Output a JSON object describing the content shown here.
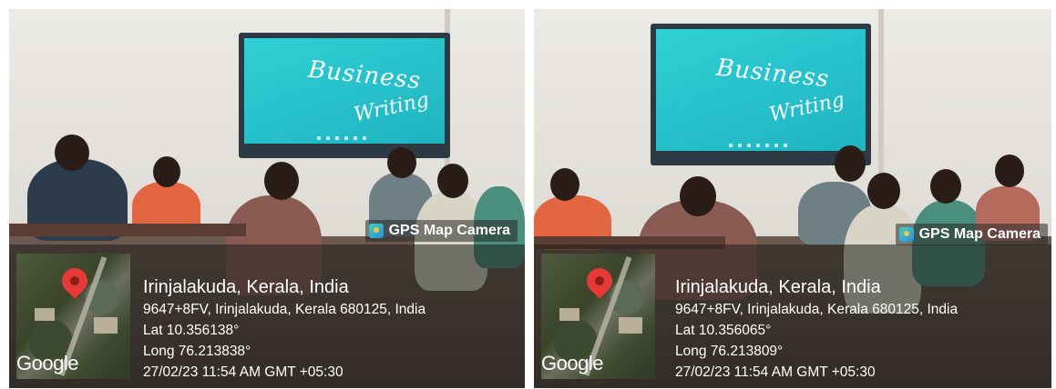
{
  "photos": [
    {
      "screen": {
        "line1": "Business",
        "line2": "Writing"
      },
      "watermark": {
        "label": "GPS Map Camera",
        "icon": "gps-camera-icon"
      },
      "location": {
        "title": "Irinjalakuda, Kerala, India",
        "address": "9647+8FV, Irinjalakuda, Kerala 680125, India",
        "lat": "Lat 10.356138°",
        "long": "Long 76.213838°",
        "datetime": "27/02/23 11:54 AM GMT +05:30"
      },
      "map": {
        "provider": "Google",
        "pin_color": "#e53935"
      }
    },
    {
      "screen": {
        "line1": "Business",
        "line2": "Writing"
      },
      "watermark": {
        "label": "GPS Map Camera",
        "icon": "gps-camera-icon"
      },
      "location": {
        "title": "Irinjalakuda, Kerala, India",
        "address": "9647+8FV, Irinjalakuda, Kerala 680125, India",
        "lat": "Lat 10.356065°",
        "long": "Long 76.213809°",
        "datetime": "27/02/23 11:54 AM GMT +05:30"
      },
      "map": {
        "provider": "Google",
        "pin_color": "#e53935"
      }
    }
  ]
}
